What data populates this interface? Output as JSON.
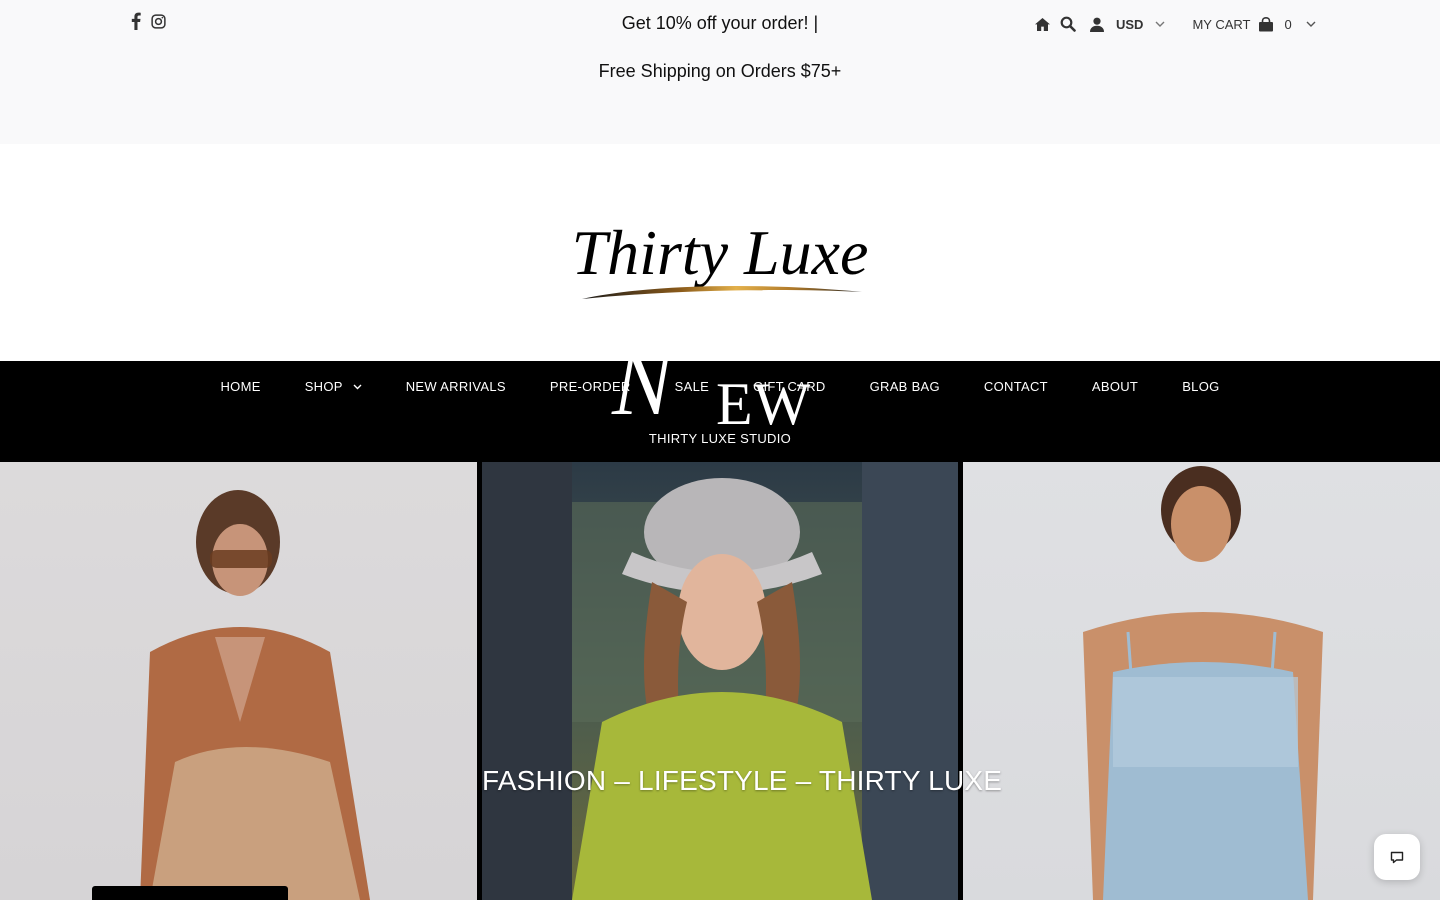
{
  "announcement": {
    "line1": "Get 10% off your order! |",
    "line2": "Free Shipping on Orders $75+"
  },
  "social": [
    {
      "name": "facebook-icon"
    },
    {
      "name": "instagram-icon"
    }
  ],
  "utility": {
    "currency": "USD",
    "cart_label": "MY CART",
    "cart_count": "0"
  },
  "brand": {
    "logo_text": "Thirty Luxe"
  },
  "nav": {
    "items": [
      {
        "label": "HOME"
      },
      {
        "label": "SHOP",
        "has_dropdown": true
      },
      {
        "label": "NEW ARRIVALS"
      },
      {
        "label": "PRE-ORDER"
      },
      {
        "label": "SALE"
      },
      {
        "label": "GIFT CARD"
      },
      {
        "label": "GRAB BAG"
      },
      {
        "label": "CONTACT"
      },
      {
        "label": "ABOUT"
      },
      {
        "label": "BLOG"
      }
    ],
    "row2": "THIRTY LUXE STUDIO"
  },
  "hero": {
    "headline": "FASHION – LIFESTYLE – THIRTY LUXE",
    "new_n": "N",
    "new_rest": "EW"
  },
  "colors": {
    "nav_bg": "#000000",
    "topbar_bg": "#f9f9fa",
    "accent_gold": "#c9962a"
  }
}
